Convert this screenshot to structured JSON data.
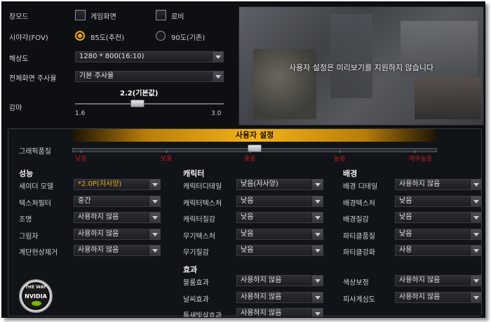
{
  "display": {
    "window_label": "창모드",
    "fullscreen_option": "게임화면",
    "lobby_option": "로비",
    "fov_label": "시야각(FOV)",
    "fov_options": [
      "85도(추천)",
      "90도(기존)"
    ],
    "fov_selected": "85도(추천)",
    "resolution_label": "해상도",
    "resolution_value": "1280 * 800(16:10)",
    "refresh_label": "전체화면 주사율",
    "refresh_value": "기본 주사율",
    "gamma_label": "감마",
    "gamma_value": "2.2(기본값)",
    "gamma_min": "1.6",
    "gamma_max": "3.0",
    "gamma_level": 0.42
  },
  "preview": {
    "message": "사용자 설정은 미리보기를 지원하지 않습니다"
  },
  "graphics": {
    "preset_title": "사용자 설정",
    "quality_label": "그래픽품질",
    "quality_levels": [
      "낮음",
      "보통",
      "좋음",
      "높음",
      "매우높음"
    ],
    "quality_level": 0.5,
    "level_color": "#c21c1c",
    "accent_color": "#f2a413"
  },
  "sections": {
    "performance": {
      "title": "성능",
      "rows": [
        {
          "label": "세이더 모델",
          "value": "*2.0P(저사양)"
        },
        {
          "label": "텍스쳐필터",
          "value": "중간"
        },
        {
          "label": "조명",
          "value": "사용하지 않음"
        },
        {
          "label": "그림자",
          "value": "사용하지 않음"
        },
        {
          "label": "계단현상제거",
          "value": "사용하지 않음"
        }
      ]
    },
    "character": {
      "title": "캐릭터",
      "rows": [
        {
          "label": "캐릭터디테일",
          "value": "낮음(저사양)"
        },
        {
          "label": "캐릭터텍스처",
          "value": "낮음"
        },
        {
          "label": "캐릭터질감",
          "value": "낮음"
        },
        {
          "label": "무기텍스처",
          "value": "낮음"
        },
        {
          "label": "무기질감",
          "value": "낮음"
        }
      ]
    },
    "background": {
      "title": "배경",
      "rows": [
        {
          "label": "배경 디테일",
          "value": "사용하지 않음"
        },
        {
          "label": "배경텍스처",
          "value": "낮음"
        },
        {
          "label": "배경질감",
          "value": "낮음"
        },
        {
          "label": "파티클품질",
          "value": "낮음"
        },
        {
          "label": "파티클강화",
          "value": "사용"
        }
      ]
    },
    "effects": {
      "title": "효과",
      "rows": [
        {
          "label": "블룸효과",
          "value": "사용하지 않음"
        },
        {
          "label": "날씨효과",
          "value": "사용하지 않음"
        },
        {
          "label": "틈새빛살효과",
          "value": "사용하지 않음"
        }
      ],
      "extra_rows": [
        {
          "label": "색상보정",
          "value": "사용하지 않음"
        },
        {
          "label": "피사계심도",
          "value": "사용하지 않음"
        }
      ]
    }
  },
  "logo": {
    "line1": "THE WAY",
    "line2": "NVIDIA"
  }
}
